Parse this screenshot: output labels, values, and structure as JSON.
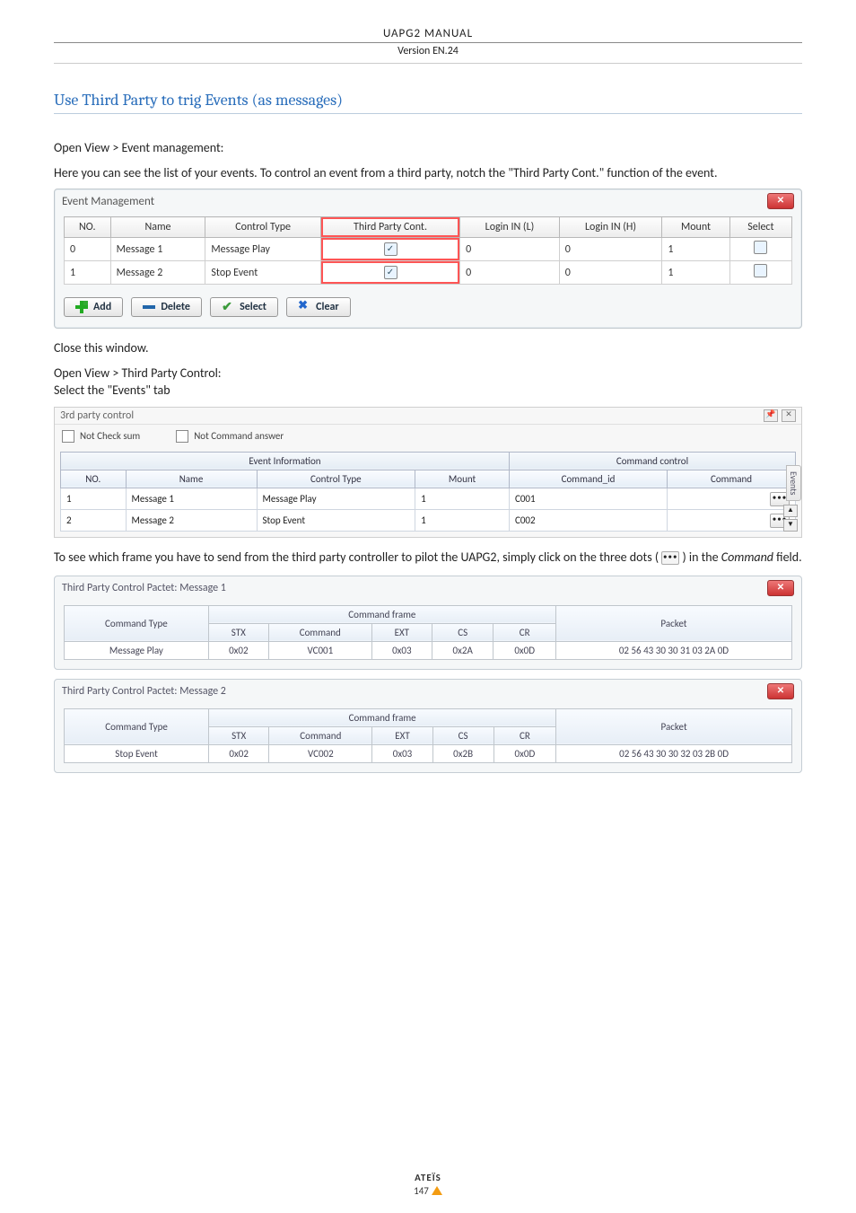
{
  "doc": {
    "header": "UAPG2  MANUAL",
    "version": "Version EN.24",
    "section_title": "Use Third Party to trig Events (as messages)",
    "p1": "Open View > Event management:",
    "p2": "Here you can see the list of your events. To control an event from a third party, notch the \"Third Party Cont.\" function of the event.",
    "p3": "Close this window.",
    "p4": "Open View > Third Party Control:",
    "p5": "Select the \"Events\" tab",
    "p6a": "To see which frame you have to send from the third party controller to pilot the UAPG2, simply click on the three dots ( ",
    "p6b": " ) in the ",
    "p6c": "Command",
    "p6d": " field."
  },
  "event_mgmt": {
    "title": "Event Management",
    "headers": {
      "no": "NO.",
      "name": "Name",
      "ctrl": "Control Type",
      "tpc": "Third Party Cont.",
      "linl": "Login IN (L)",
      "linh": "Login IN (H)",
      "mount": "Mount",
      "select": "Select"
    },
    "rows": [
      {
        "no": "0",
        "name": "Message 1",
        "ctrl": "Message Play",
        "tpc": true,
        "linl": "0",
        "linh": "0",
        "mount": "1",
        "select": false
      },
      {
        "no": "1",
        "name": "Message 2",
        "ctrl": "Stop Event",
        "tpc": true,
        "linl": "0",
        "linh": "0",
        "mount": "1",
        "select": false
      }
    ],
    "buttons": {
      "add": "Add",
      "delete": "Delete",
      "select": "Select",
      "clear": "Clear"
    }
  },
  "tpc_panel": {
    "title": "3rd party control",
    "not_check_sum": "Not Check sum",
    "not_cmd_answer": "Not Command answer",
    "group_event": "Event Information",
    "group_cmd": "Command control",
    "side_tab": "Events",
    "headers": {
      "no": "NO.",
      "name": "Name",
      "ctrl": "Control Type",
      "mount": "Mount",
      "cmdid": "Command_id",
      "cmd": "Command"
    },
    "rows": [
      {
        "no": "1",
        "name": "Message 1",
        "ctrl": "Message Play",
        "mount": "1",
        "cmdid": "C001"
      },
      {
        "no": "2",
        "name": "Message 2",
        "ctrl": "Stop Event",
        "mount": "1",
        "cmdid": "C002"
      }
    ]
  },
  "pkt1": {
    "title": "Third Party Control Pactet: Message 1",
    "hdr": {
      "cmdtype": "Command Type",
      "frame": "Command frame",
      "packet": "Packet",
      "stx": "STX",
      "command": "Command",
      "ext": "EXT",
      "cs": "CS",
      "cr": "CR"
    },
    "row": {
      "cmdtype": "Message Play",
      "stx": "0x02",
      "command": "VC001",
      "ext": "0x03",
      "cs": "0x2A",
      "cr": "0x0D",
      "packet": "02 56 43 30 30 31 03 2A 0D"
    }
  },
  "pkt2": {
    "title": "Third Party Control Pactet: Message 2",
    "hdr": {
      "cmdtype": "Command Type",
      "frame": "Command frame",
      "packet": "Packet",
      "stx": "STX",
      "command": "Command",
      "ext": "EXT",
      "cs": "CS",
      "cr": "CR"
    },
    "row": {
      "cmdtype": "Stop Event",
      "stx": "0x02",
      "command": "VC002",
      "ext": "0x03",
      "cs": "0x2B",
      "cr": "0x0D",
      "packet": "02 56 43 30 30 32 03 2B 0D"
    }
  },
  "footer": {
    "brand": "ATEÏS",
    "page": "147"
  }
}
